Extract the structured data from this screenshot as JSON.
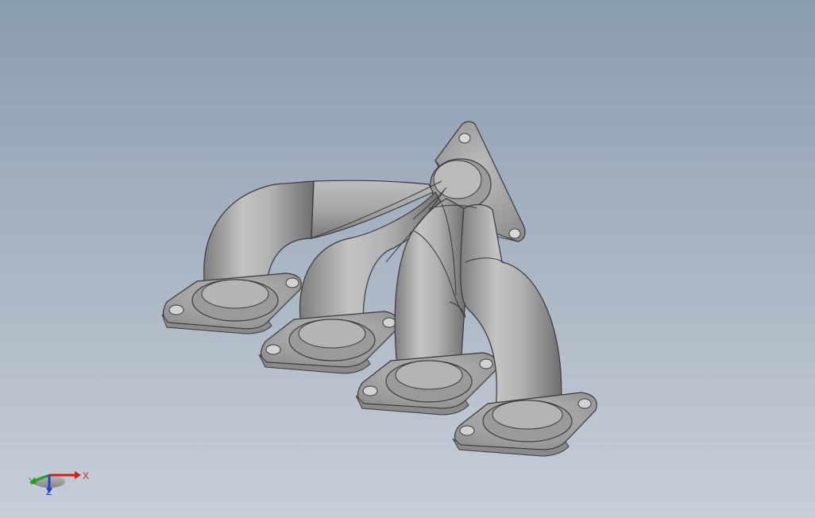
{
  "viewport": {
    "background_top": "#8c9db0",
    "background_bottom": "#c7cdd6",
    "model_color": "#a9a9a9",
    "edge_color": "#3a3a3a"
  },
  "model": {
    "part": "exhaust-manifest",
    "runner_count": 4,
    "flange_count": 5
  },
  "triad": {
    "x_label": "X",
    "y_label": "Y",
    "z_label": "Z",
    "x_color": "#d02020",
    "y_color": "#20a020",
    "z_color": "#2040d0"
  }
}
